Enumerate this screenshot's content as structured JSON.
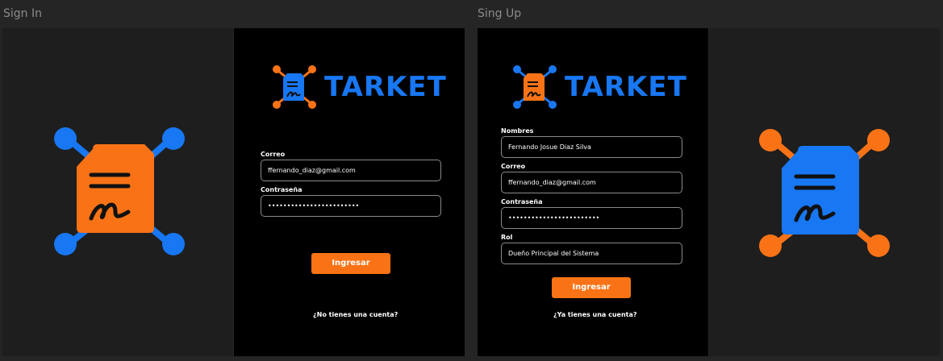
{
  "colors": {
    "orange": "#f97316",
    "blue": "#1877f2",
    "canvas": "#252525",
    "panel_dark": "#1e1e1e",
    "panel_black": "#000000"
  },
  "signin": {
    "frame_title": "Sign In",
    "brand": "TARKET",
    "email_label": "Correo",
    "email_value": "ffernando_diaz@gmail.com",
    "password_label": "Contraseña",
    "password_value": "••••••••••••••••••••••••",
    "submit_label": "Ingresar",
    "switch_link": "¿No tienes una cuenta?"
  },
  "signup": {
    "frame_title": "Sing Up",
    "brand": "TARKET",
    "name_label": "Nombres",
    "name_value": "Fernando Josue Diaz Silva",
    "email_label": "Correo",
    "email_value": "ffernando_diaz@gmail.com",
    "password_label": "Contraseña",
    "password_value": "••••••••••••••••••••••••",
    "role_label": "Rol",
    "role_value": "Dueño Principal del Sistema",
    "submit_label": "Ingresar",
    "switch_link": "¿Ya tienes una cuenta?"
  }
}
